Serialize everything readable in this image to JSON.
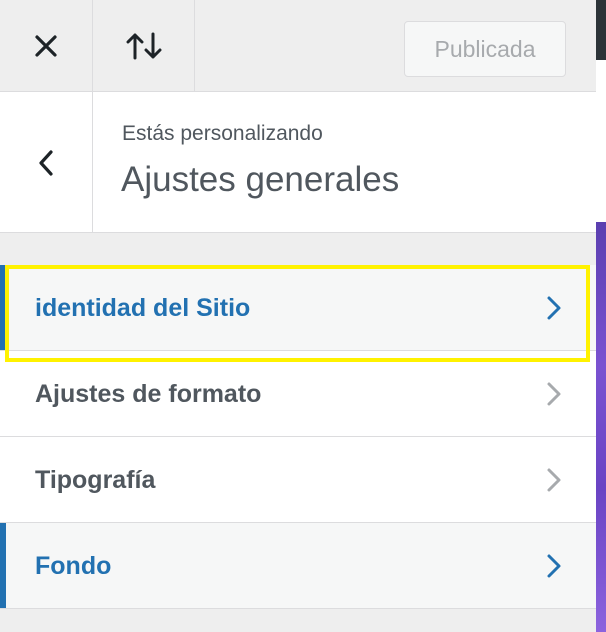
{
  "header": {
    "close_icon": "close-icon",
    "sort_icon": "sort-arrows-icon",
    "publish_label": "Publicada"
  },
  "info": {
    "back_icon": "chevron-left-icon",
    "subtitle": "Estás personalizando",
    "title": "Ajustes generales"
  },
  "sections": [
    {
      "label": "identidad del Sitio",
      "active": true,
      "highlighted": true
    },
    {
      "label": "Ajustes de formato",
      "active": false
    },
    {
      "label": "Tipografía",
      "active": false
    },
    {
      "label": "Fondo",
      "active": true
    }
  ],
  "colors": {
    "accent": "#2271b1",
    "highlight": "#fff200",
    "text": "#50575e",
    "chevron_inactive": "#a7aaad"
  }
}
